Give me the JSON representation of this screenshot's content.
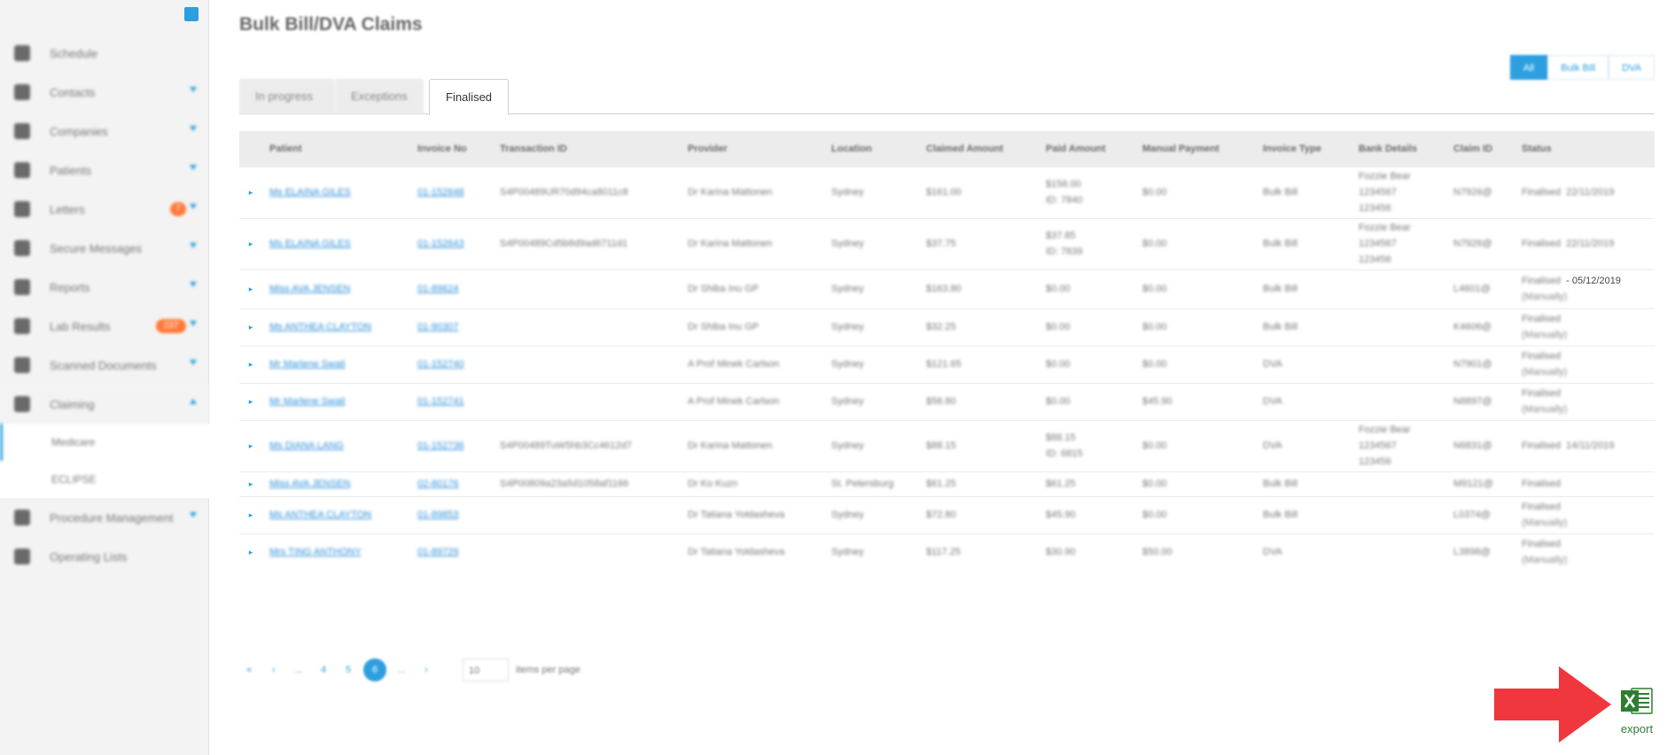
{
  "sidebar": {
    "items": [
      {
        "label": "Schedule",
        "chevron": false,
        "badge": ""
      },
      {
        "label": "Contacts",
        "chevron": true,
        "badge": ""
      },
      {
        "label": "Companies",
        "chevron": true,
        "badge": ""
      },
      {
        "label": "Patients",
        "chevron": true,
        "badge": ""
      },
      {
        "label": "Letters",
        "chevron": true,
        "badge": "7"
      },
      {
        "label": "Secure Messages",
        "chevron": true,
        "badge": ""
      },
      {
        "label": "Reports",
        "chevron": true,
        "badge": ""
      },
      {
        "label": "Lab Results",
        "chevron": true,
        "badge": "237"
      },
      {
        "label": "Scanned Documents",
        "chevron": true,
        "badge": ""
      },
      {
        "label": "Claiming",
        "chevron": true,
        "badge": ""
      }
    ],
    "sub_items": [
      "Medicare",
      "ECLIPSE"
    ],
    "bottom_items": [
      {
        "label": "Procedure Management",
        "chevron": true
      },
      {
        "label": "Operating Lists",
        "chevron": false
      }
    ]
  },
  "page": {
    "title": "Bulk Bill/DVA Claims"
  },
  "filters": [
    "All",
    "Bulk Bill",
    "DVA"
  ],
  "tabs": [
    "In progress",
    "Exceptions",
    "Finalised"
  ],
  "table": {
    "headers": [
      "Patient",
      "Invoice No",
      "Transaction ID",
      "Provider",
      "Location",
      "Claimed Amount",
      "Paid Amount",
      "Manual Payment",
      "Invoice Type",
      "Bank Details",
      "Claim ID",
      "Status"
    ],
    "rows": [
      {
        "patient": "Ms ELAINA GILES",
        "invoice": "01-152648",
        "txn": "S4P00489UR70d94ca8011c8",
        "provider": "Dr Karina Mattonen",
        "location": "Sydney",
        "claimed": "$161.00",
        "paid": "$158.00",
        "paid2": "ID: 7840",
        "manual": "$0.00",
        "type": "Bulk Bill",
        "bank": [
          "Fozzie Bear",
          "1234567",
          "123456"
        ],
        "claim": "N7926@",
        "status": "Finalised",
        "status2": "",
        "date": "22/11/2019",
        "date_sharp": false
      },
      {
        "patient": "Ms ELAINA GILES",
        "invoice": "01-152643",
        "txn": "S4P00489Cd5b8d9ad6711d1",
        "provider": "Dr Karina Mattonen",
        "location": "Sydney",
        "claimed": "$37.75",
        "paid": "$37.85",
        "paid2": "ID: 7839",
        "manual": "$0.00",
        "type": "Bulk Bill",
        "bank": [
          "Fozzie Bear",
          "1234567",
          "123456"
        ],
        "claim": "N7926@",
        "status": "Finalised",
        "status2": "",
        "date": "22/11/2019",
        "date_sharp": false
      },
      {
        "patient": "Miss AVA JENSEN",
        "invoice": "01-89624",
        "txn": "",
        "provider": "Dr Shiba Inu GP",
        "location": "Sydney",
        "claimed": "$163.80",
        "paid": "$0.00",
        "paid2": "",
        "manual": "$0.00",
        "type": "Bulk Bill",
        "bank": [],
        "claim": "L4601@",
        "status": "Finalised",
        "status2": "(Manually)",
        "date": "- 05/12/2019",
        "date_sharp": true
      },
      {
        "patient": "Ms ANTHEA CLAYTON",
        "invoice": "01-90307",
        "txn": "",
        "provider": "Dr Shiba Inu GP",
        "location": "Sydney",
        "claimed": "$32.25",
        "paid": "$0.00",
        "paid2": "",
        "manual": "$0.00",
        "type": "Bulk Bill",
        "bank": [],
        "claim": "K4606@",
        "status": "Finalised",
        "status2": "(Manually)",
        "date": "",
        "date_sharp": false
      },
      {
        "patient": "Mr Marlene Swati",
        "invoice": "01-152740",
        "txn": "",
        "provider": "A Prof Minek Carlson",
        "location": "Sydney",
        "claimed": "$121.65",
        "paid": "$0.00",
        "paid2": "",
        "manual": "$0.00",
        "type": "DVA",
        "bank": [],
        "claim": "N7901@",
        "status": "Finalised",
        "status2": "(Manually)",
        "date": "",
        "date_sharp": false
      },
      {
        "patient": "Mr Marlene Swati",
        "invoice": "01-152741",
        "txn": "",
        "provider": "A Prof Minek Carlson",
        "location": "Sydney",
        "claimed": "$58.80",
        "paid": "$0.00",
        "paid2": "",
        "manual": "$45.90",
        "type": "DVA",
        "bank": [],
        "claim": "N8897@",
        "status": "Finalised",
        "status2": "(Manually)",
        "date": "",
        "date_sharp": false
      },
      {
        "patient": "Ms DIANA LANG",
        "invoice": "01-152736",
        "txn": "S4P00489TuW5hb3Cc4612d7",
        "provider": "Dr Karina Mattonen",
        "location": "Sydney",
        "claimed": "$88.15",
        "paid": "$88.15",
        "paid2": "ID: 6815",
        "manual": "$0.00",
        "type": "DVA",
        "bank": [
          "Fozzie Bear",
          "1234567",
          "123456"
        ],
        "claim": "N6831@",
        "status": "Finalised",
        "status2": "",
        "date": "14/11/2019",
        "date_sharp": false
      },
      {
        "patient": "Miss AVA JENSEN",
        "invoice": "02-80176",
        "txn": "S4P00809a23a5d1058af1166",
        "provider": "Dr Ko Kuzn",
        "location": "St. Petersburg",
        "claimed": "$61.25",
        "paid": "$61.25",
        "paid2": "",
        "manual": "$0.00",
        "type": "Bulk Bill",
        "bank": [],
        "claim": "M9121@",
        "status": "Finalised",
        "status2": "",
        "date": "",
        "date_sharp": false
      },
      {
        "patient": "Ms ANTHEA CLAYTON",
        "invoice": "01-89853",
        "txn": "",
        "provider": "Dr Tatiana Yoldasheva",
        "location": "Sydney",
        "claimed": "$72.80",
        "paid": "$45.90",
        "paid2": "",
        "manual": "$0.00",
        "type": "Bulk Bill",
        "bank": [],
        "claim": "L0374@",
        "status": "Finalised",
        "status2": "(Manually)",
        "date": "",
        "date_sharp": false
      },
      {
        "patient": "Mrs TING ANTHONY",
        "invoice": "01-89729",
        "txn": "",
        "provider": "Dr Tatiana Yoldasheva",
        "location": "Sydney",
        "claimed": "$117.25",
        "paid": "$30.90",
        "paid2": "",
        "manual": "$50.00",
        "type": "DVA",
        "bank": [],
        "claim": "L3898@",
        "status": "Finalised",
        "status2": "(Manually)",
        "date": "",
        "date_sharp": false
      }
    ]
  },
  "pager": {
    "buttons": [
      "«",
      "‹",
      "...",
      "4",
      "5",
      "6",
      "...",
      "›"
    ],
    "active_index": 5,
    "per_page_value": "10",
    "per_page_label": "items per page"
  },
  "export": {
    "label": "export",
    "icon": "excel-icon",
    "color": "#2e7d32",
    "arrow_color": "#f0373e"
  },
  "colors": {
    "accent": "#2d9fe0",
    "badge": "#ff7a3a"
  }
}
